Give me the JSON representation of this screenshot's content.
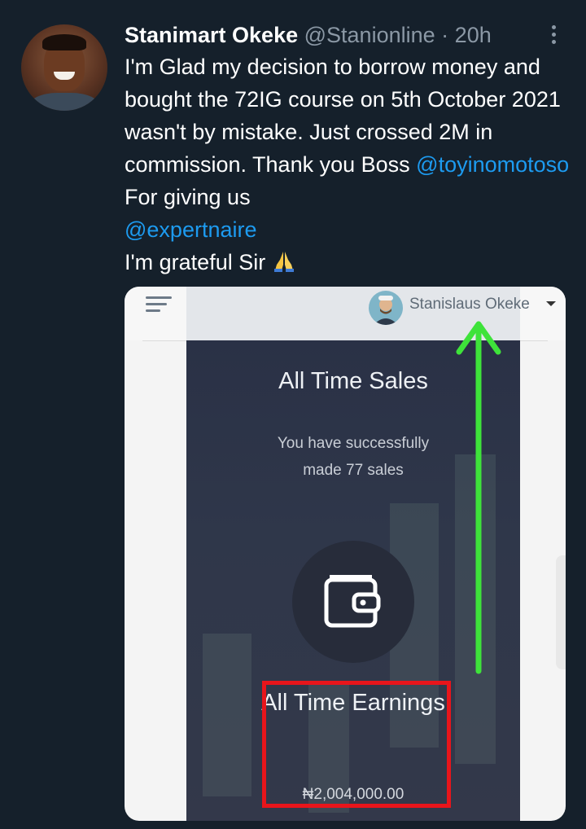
{
  "tweet": {
    "author_name": "Stanimart Okeke",
    "author_handle": "@Stanionline",
    "separator": "·",
    "time": "20h",
    "text_line_1": "I'm Glad my decision to borrow money and bought the 72IG course on 5th October 2021 wasn't by mistake. Just crossed 2M in commission. Thank you Boss ",
    "mention_1": "@toyinomotoso",
    "text_line_2": " For giving us ",
    "mention_2": "@expertnaire",
    "text_line_3": "I'm grateful Sir",
    "emoji": "folded-hands",
    "colors": {
      "background": "#15202b",
      "mention": "#1d9bf0",
      "secondary_text": "#8b98a5"
    }
  },
  "screenshot": {
    "user_name": "Stanislaus Okeke",
    "sales_title": "All Time Sales",
    "sales_text": "You have successfully made 77 sales",
    "earnings_title": "All Time Earnings",
    "earnings_value": "₦2,004,000.00",
    "icons": [
      "menu-icon",
      "wallet-icon",
      "dropdown-caret-icon"
    ],
    "annotations": {
      "highlight_color": "#e8151b",
      "arrow_color": "#3ee33a"
    }
  }
}
